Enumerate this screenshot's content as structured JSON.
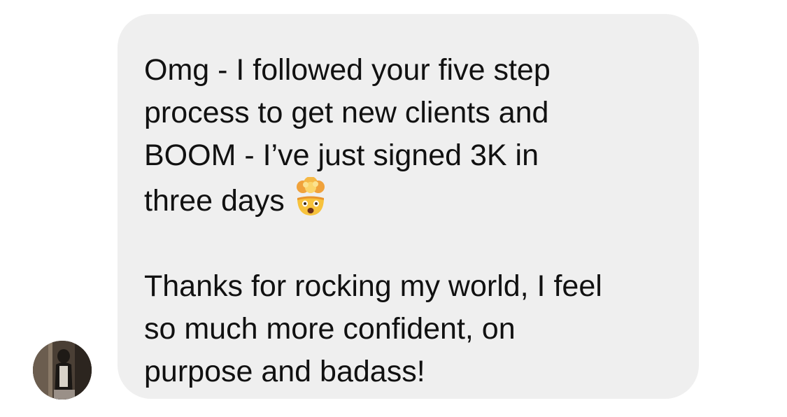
{
  "message": {
    "paragraph1_lines": [
      "Omg - I followed your five step",
      "process to get new clients and",
      "BOOM - I’ve just signed 3K in",
      "three days"
    ],
    "paragraph2_lines": [
      "Thanks for rocking my world, I feel",
      "so much more confident, on",
      "purpose and badass!"
    ],
    "emoji": "exploding-head-icon"
  },
  "colors": {
    "bubble_bg": "#efefef",
    "text": "#111111",
    "page_bg": "#ffffff"
  }
}
